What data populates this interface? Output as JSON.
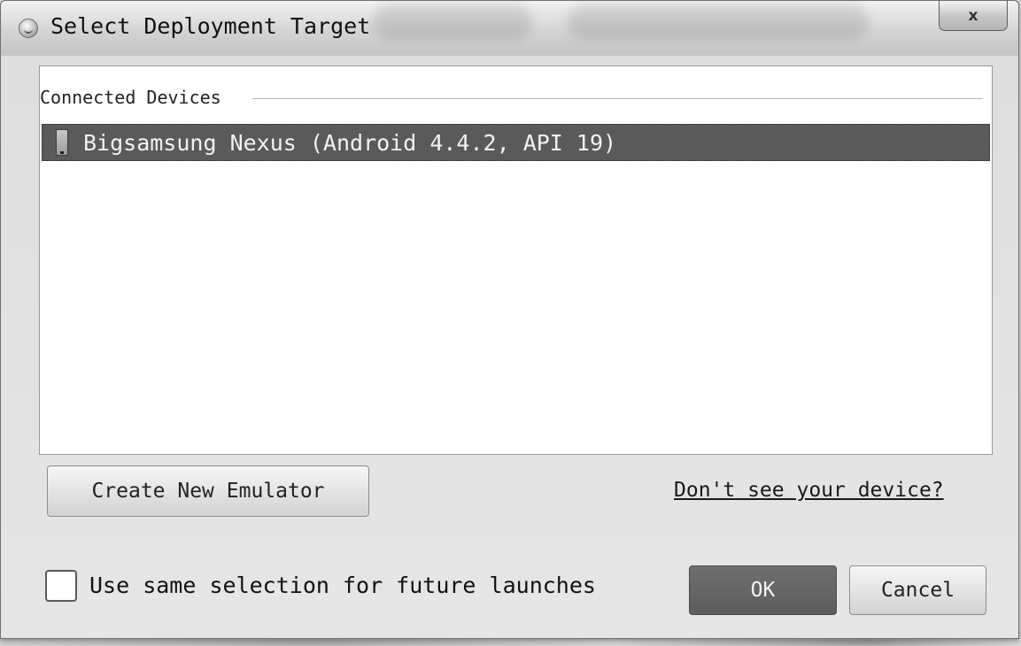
{
  "window": {
    "title": "Select Deployment Target",
    "close_label": "x",
    "app_icon": "android-studio-icon"
  },
  "device_list": {
    "group_label": "Connected Devices",
    "devices": [
      {
        "label": "Bigsamsung Nexus (Android 4.4.2, API 19)",
        "icon": "phone-icon",
        "selected": true
      }
    ]
  },
  "actions": {
    "create_emulator_label": "Create New Emulator",
    "help_link_label": "Don't see your device?"
  },
  "footer": {
    "remember_label": "Use same selection for future launches",
    "remember_checked": false,
    "ok_label": "OK",
    "cancel_label": "Cancel"
  },
  "colors": {
    "selection_background": "#5a5a5a",
    "selection_text": "#f2f2f2",
    "ok_button": "#666666"
  }
}
